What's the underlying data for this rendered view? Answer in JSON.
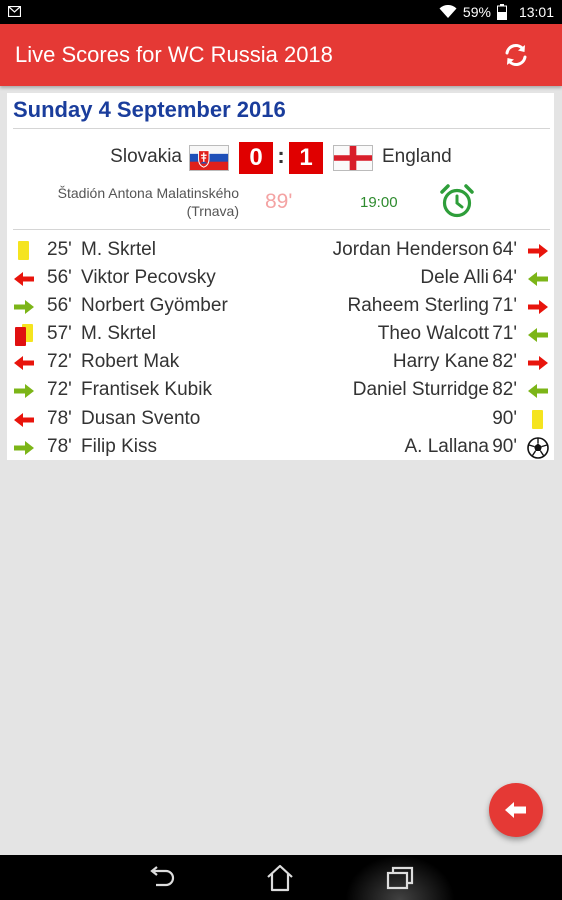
{
  "status_bar": {
    "battery": "59%",
    "time": "13:01",
    "icons": [
      "notification-icon",
      "wifi-icon",
      "battery-icon"
    ]
  },
  "app_bar": {
    "title": "Live Scores for WC Russia 2018",
    "refresh_icon": "refresh-icon"
  },
  "match": {
    "date": "Sunday 4 September 2016",
    "home_team": "Slovakia",
    "away_team": "England",
    "home_score": "0",
    "away_score": "1",
    "separator": ":",
    "stadium_name": "Štadión Antona Malatinského",
    "stadium_city": "(Trnava)",
    "minute": "89'",
    "kickoff_time": "19:00",
    "alarm_icon": "alarm-clock-icon"
  },
  "events": {
    "home": [
      {
        "minute": "25'",
        "player": "M. Skrtel",
        "icon": "yellow-card-icon"
      },
      {
        "minute": "56'",
        "player": "Viktor Pecovsky",
        "icon": "sub-out-icon"
      },
      {
        "minute": "56'",
        "player": "Norbert Gyömber",
        "icon": "sub-in-icon"
      },
      {
        "minute": "57'",
        "player": "M. Skrtel",
        "icon": "red-card-icon"
      },
      {
        "minute": "72'",
        "player": "Robert Mak",
        "icon": "sub-out-icon"
      },
      {
        "minute": "72'",
        "player": "Frantisek Kubik",
        "icon": "sub-in-icon"
      },
      {
        "minute": "78'",
        "player": "Dusan Svento",
        "icon": "sub-out-icon"
      },
      {
        "minute": "78'",
        "player": "Filip Kiss",
        "icon": "sub-in-icon"
      }
    ],
    "away": [
      {
        "minute": "64'",
        "player": "Jordan Henderson",
        "icon": "sub-out-icon"
      },
      {
        "minute": "64'",
        "player": "Dele Alli",
        "icon": "sub-in-icon"
      },
      {
        "minute": "71'",
        "player": "Raheem Sterling",
        "icon": "sub-out-icon"
      },
      {
        "minute": "71'",
        "player": "Theo Walcott",
        "icon": "sub-in-icon"
      },
      {
        "minute": "82'",
        "player": "Harry Kane",
        "icon": "sub-out-icon"
      },
      {
        "minute": "82'",
        "player": "Daniel Sturridge",
        "icon": "sub-in-icon"
      },
      {
        "minute": "90'",
        "player": "",
        "icon": "yellow-card-icon"
      },
      {
        "minute": "90'",
        "player": "A. Lallana",
        "icon": "goal-ball-icon"
      }
    ]
  },
  "fab": {
    "icon": "back-arrow-icon"
  },
  "nav_bar": {
    "icons": [
      "nav-back-icon",
      "nav-home-icon",
      "nav-recents-icon"
    ]
  },
  "colors": {
    "accent": "#e53935",
    "date_blue": "#1a3d9c",
    "score_red": "#e00000",
    "minute_pink": "#f4a3a3",
    "kickoff_green": "#2e8b2e",
    "sub_in_green": "#7cb518",
    "sub_out_red": "#e8140c",
    "yellow_card": "#f5e41f"
  }
}
